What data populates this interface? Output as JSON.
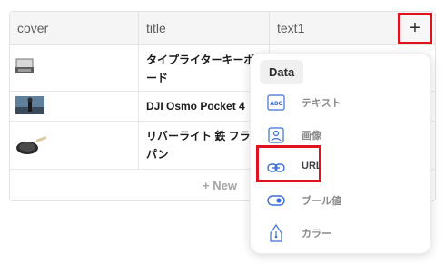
{
  "table": {
    "columns": [
      {
        "id": "cover",
        "label": "cover"
      },
      {
        "id": "title",
        "label": "title"
      },
      {
        "id": "text1",
        "label": "text1"
      }
    ],
    "add_column_icon": "plus-icon",
    "rows": [
      {
        "title": "タイプライターキーボード",
        "thumb": "typewriter-keyboard-thumbnail"
      },
      {
        "title": "DJI Osmo Pocket 4",
        "thumb": "osmo-pocket-thumbnail"
      },
      {
        "title": "リバーライト 鉄 フライパン",
        "thumb": "frying-pan-thumbnail"
      }
    ],
    "new_row_label": "+ New"
  },
  "menu": {
    "section_title": "Data",
    "items": [
      {
        "label": "テキスト",
        "icon": "text-abc-icon"
      },
      {
        "label": "画像",
        "icon": "image-icon"
      },
      {
        "label": "URL",
        "icon": "link-icon"
      },
      {
        "label": "ブール値",
        "icon": "toggle-icon"
      },
      {
        "label": "カラー",
        "icon": "color-pen-icon"
      }
    ]
  },
  "colors": {
    "highlight": "#e0121f",
    "icon_blue": "#3b6fd6"
  }
}
